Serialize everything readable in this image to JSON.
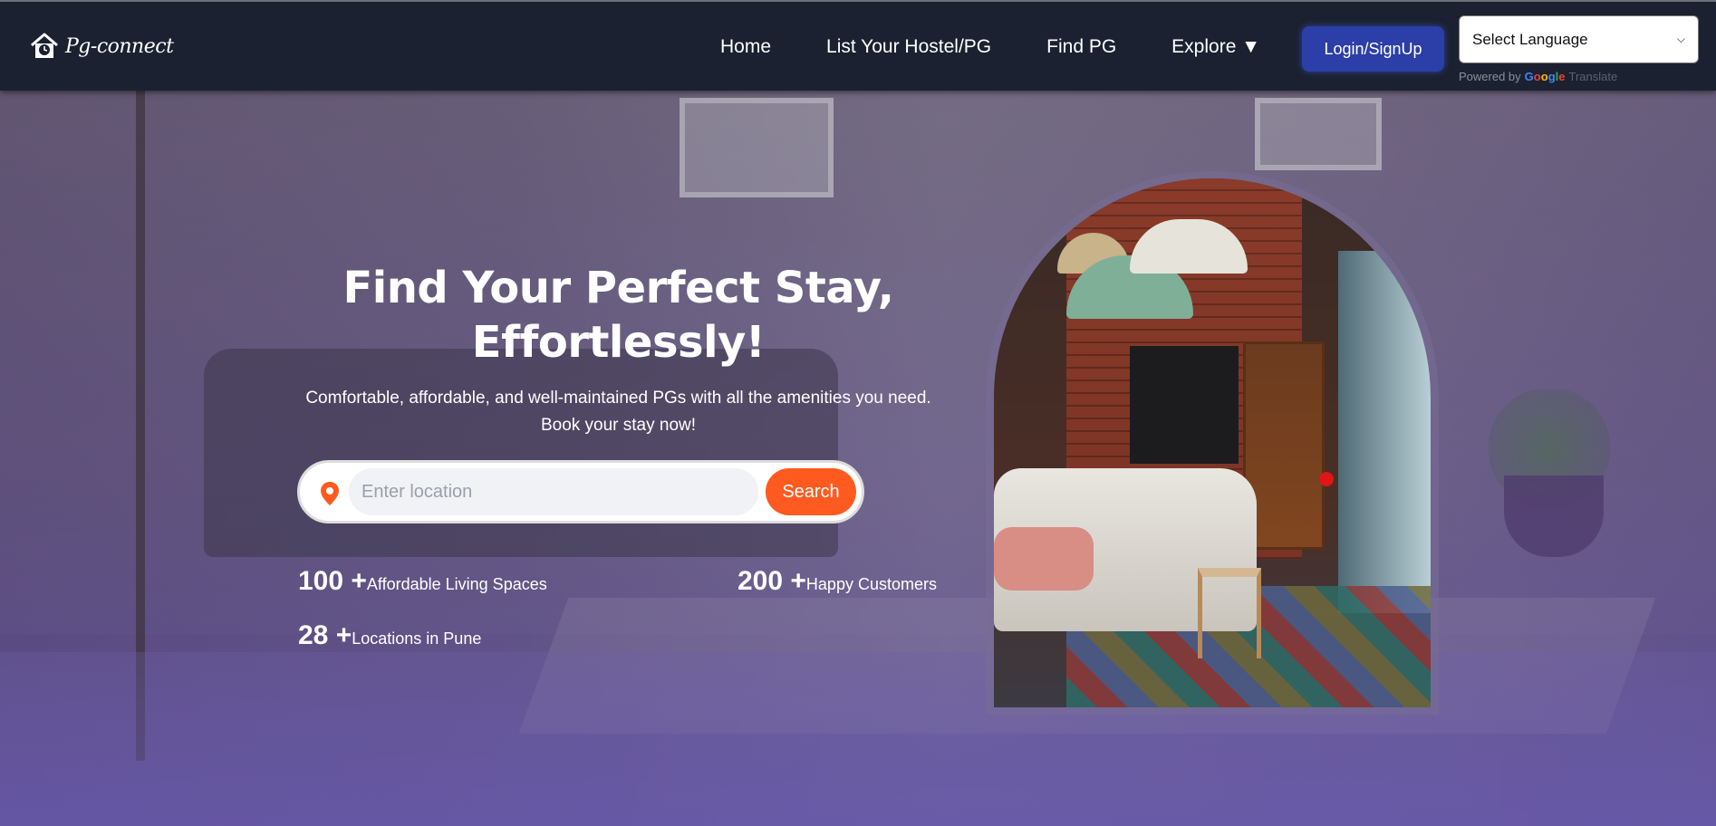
{
  "brand": {
    "name": "Pg-connect",
    "icon": "house-clock-icon"
  },
  "nav": {
    "items": [
      {
        "label": "Home"
      },
      {
        "label": "List Your Hostel/PG"
      },
      {
        "label": "Find PG"
      },
      {
        "label": "Explore ▼"
      }
    ],
    "login_label": "Login/SignUp",
    "language_select": "Select Language",
    "powered_by": "Powered by",
    "google": "Google",
    "translate": "Translate"
  },
  "hero": {
    "title": "Find Your Perfect Stay, Effortlessly!",
    "subtitle": "Comfortable, affordable, and well-maintained PGs with all the amenities you need. Book your stay now!",
    "search_placeholder": "Enter location",
    "search_label": "Search",
    "stats": [
      {
        "number": "100 +",
        "label": "Affordable Living Spaces"
      },
      {
        "number": "200 +",
        "label": "Happy Customers"
      },
      {
        "number": "28 +",
        "label": "Locations in Pune"
      }
    ]
  },
  "colors": {
    "nav_bg": "#1b2130",
    "login_btn": "#2c3ea8",
    "search_btn": "#ff5a1f",
    "pin": "#ff5a1f"
  }
}
